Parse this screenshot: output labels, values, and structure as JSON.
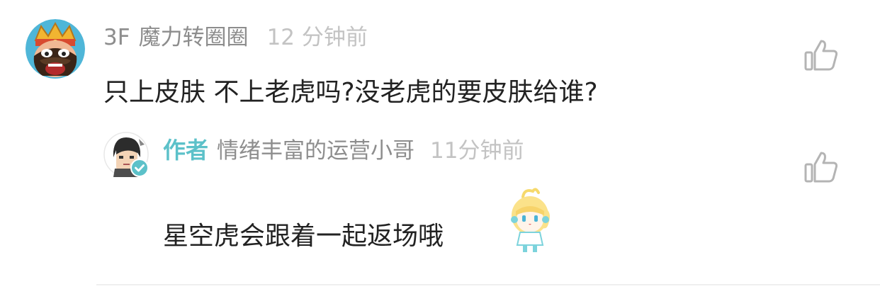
{
  "comment": {
    "floor": "3F",
    "username": "魔力转圈圈",
    "time": "12 分钟前",
    "text": "只上皮肤 不上老虎吗?没老虎的要皮肤给谁?",
    "avatar_icon": "bearded-king-avatar",
    "like_icon": "thumbs-up-icon"
  },
  "reply": {
    "author_tag": "作者",
    "username": "情绪丰富的运营小哥",
    "time": "11分钟前",
    "text": "星空虎会跟着一起返场哦",
    "avatar_icon": "character-avatar",
    "verified_icon": "verified-check-icon",
    "sticker_icon": "girl-sticker-icon",
    "like_icon": "thumbs-up-icon"
  },
  "colors": {
    "accent": "#5cc1c9",
    "meta_text": "#8d8d8d",
    "time_text": "#c3c3c3",
    "body_text": "#222222",
    "icon": "#b4b4b4"
  }
}
